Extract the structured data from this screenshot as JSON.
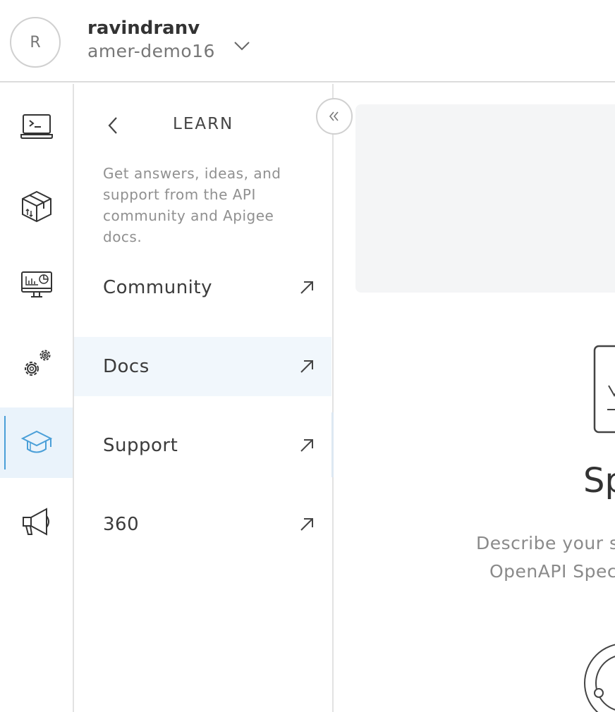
{
  "header": {
    "avatar_initial": "R",
    "user_name": "ravindranv",
    "org_name": "amer-demo16"
  },
  "rail": {
    "items": [
      {
        "icon": "terminal-laptop-icon"
      },
      {
        "icon": "package-box-icon"
      },
      {
        "icon": "analytics-monitor-icon"
      },
      {
        "icon": "settings-gears-icon"
      },
      {
        "icon": "graduation-cap-icon",
        "active": true
      },
      {
        "icon": "megaphone-icon"
      }
    ],
    "active_color": "#4a9fd8"
  },
  "learn_panel": {
    "title": "LEARN",
    "description": "Get answers, ideas, and support from the API community and Apigee docs.",
    "links": [
      {
        "label": "Community"
      },
      {
        "label": "Docs",
        "hovered": true
      },
      {
        "label": "Support"
      },
      {
        "label": "360"
      }
    ]
  },
  "main": {
    "heading": "Sp",
    "description_line1": "Describe your s",
    "description_line2": "OpenAPI Spec"
  }
}
